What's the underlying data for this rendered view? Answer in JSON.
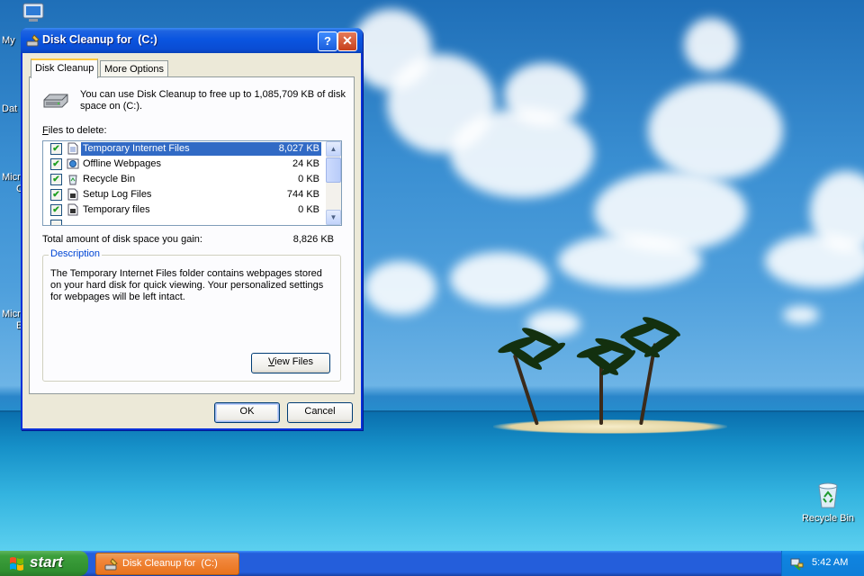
{
  "desktop": {
    "icons": [
      {
        "label": "My"
      },
      {
        "label": "Dat"
      },
      {
        "label": "Micr"
      },
      {
        "label": "C"
      },
      {
        "label": "Micr"
      },
      {
        "label": "E"
      }
    ],
    "recycle_bin_label": "Recycle Bin"
  },
  "window": {
    "title": "Disk Cleanup for  (C:)",
    "help_glyph": "?",
    "close_glyph": "✕",
    "tabs": [
      {
        "label": "Disk Cleanup",
        "active": true
      },
      {
        "label": "More Options",
        "active": false
      }
    ],
    "intro_text": "You can use Disk Cleanup to free up to 1,085,709 KB of disk space on  (C:).",
    "files_label_accel": "F",
    "files_label_rest": "iles to delete:",
    "files": [
      {
        "name": "Temporary Internet Files",
        "size": "8,027 KB",
        "checked": true,
        "selected": true,
        "icon": "document-icon"
      },
      {
        "name": "Offline Webpages",
        "size": "24 KB",
        "checked": true,
        "selected": false,
        "icon": "web-page-icon"
      },
      {
        "name": "Recycle Bin",
        "size": "0 KB",
        "checked": true,
        "selected": false,
        "icon": "recycle-bin-icon"
      },
      {
        "name": "Setup Log Files",
        "size": "744 KB",
        "checked": true,
        "selected": false,
        "icon": "log-file-icon"
      },
      {
        "name": "Temporary files",
        "size": "0 KB",
        "checked": true,
        "selected": false,
        "icon": "temp-file-icon"
      }
    ],
    "total_label": "Total amount of disk space you gain:",
    "total_value": "8,826 KB",
    "description_title": "Description",
    "description_text": "The Temporary Internet Files folder contains webpages stored on your hard disk for quick viewing. Your personalized settings for webpages will be left intact.",
    "view_files_accel": "V",
    "view_files_rest": "iew Files",
    "ok_label": "OK",
    "cancel_label": "Cancel"
  },
  "taskbar": {
    "start_label": "start",
    "task_label": "Disk Cleanup for  (C:)",
    "clock": "5:42 AM"
  },
  "colors": {
    "titlebar": "#0a55e0",
    "selection": "#316ac5",
    "taskbar": "#245edb",
    "start_button": "#3c9f3c",
    "active_task": "#f1873c"
  }
}
